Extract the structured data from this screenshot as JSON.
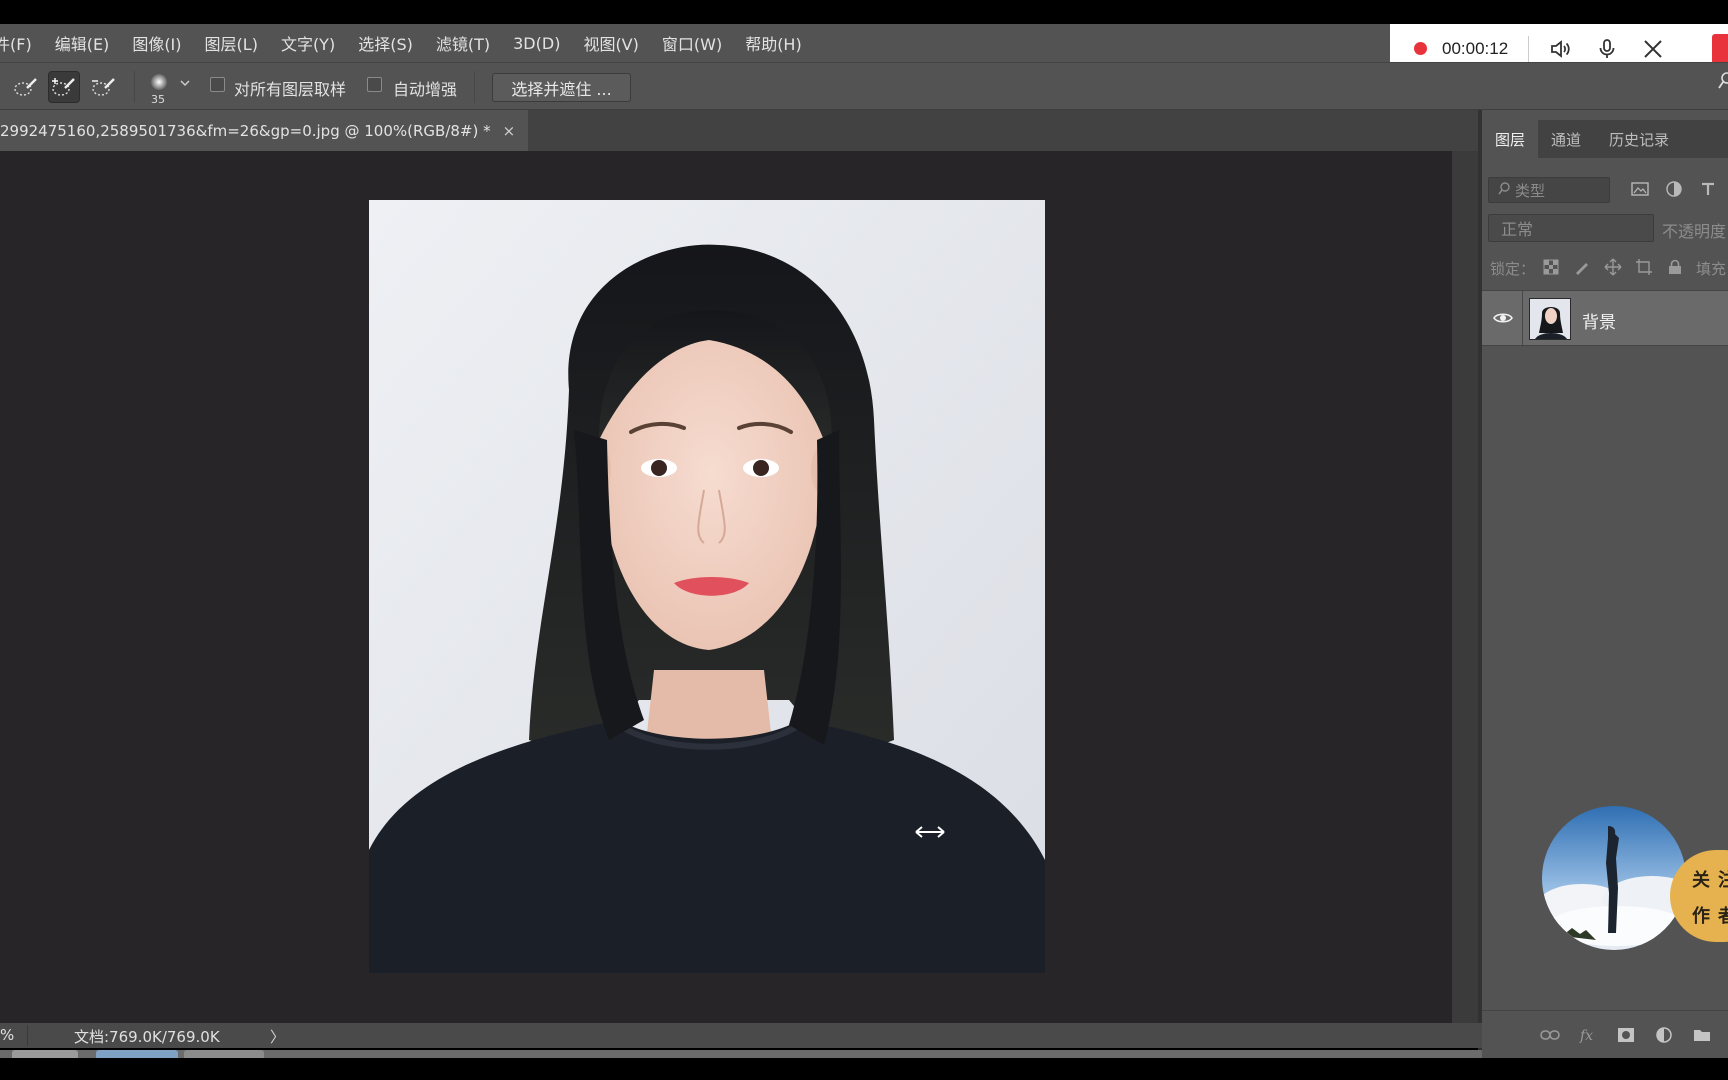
{
  "menu": [
    "件(F)",
    "编辑(E)",
    "图像(I)",
    "图层(L)",
    "文字(Y)",
    "选择(S)",
    "滤镜(T)",
    "3D(D)",
    "视图(V)",
    "窗口(W)",
    "帮助(H)"
  ],
  "recorder": {
    "time": "00:00:12"
  },
  "options": {
    "brush_size": "35",
    "sample_all_layers_label": "对所有图层取样",
    "auto_enhance_label": "自动增强",
    "select_and_mask_label": "选择并遮住 ..."
  },
  "document": {
    "tab_title": "2992475160,2589501736&fm=26&gp=0.jpg @ 100%(RGB/8#) *",
    "close_glyph": "×"
  },
  "status": {
    "zoom": "%",
    "doc_size": "文档:769.0K/769.0K",
    "arrow": "〉"
  },
  "panel": {
    "tabs": [
      "图层",
      "通道",
      "历史记录"
    ],
    "filter_placeholder": "类型",
    "blend_mode": "正常",
    "opacity_label": "不透明度",
    "lock_label": "锁定：",
    "fill_label": "填充",
    "layer_name": "背景"
  },
  "overlay": {
    "follow_chars": [
      "关",
      "注",
      "作",
      "者"
    ]
  },
  "colors": {
    "ui_dark": "#535353",
    "canvas_bg": "#282529",
    "recorder_red": "#e8333c"
  }
}
